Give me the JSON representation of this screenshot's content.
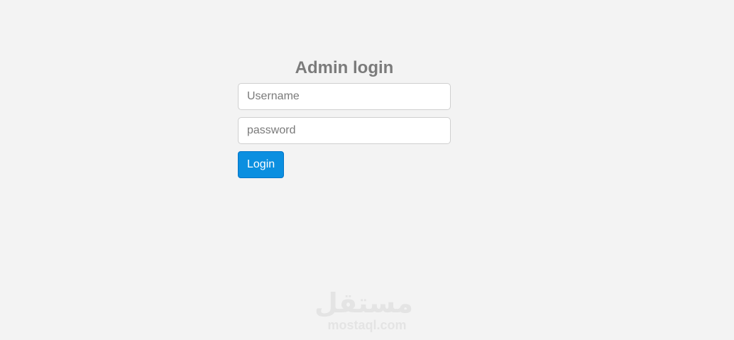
{
  "login_form": {
    "title": "Admin login",
    "username_placeholder": "Username",
    "password_placeholder": "password",
    "username_value": "",
    "password_value": "",
    "login_label": "Login"
  },
  "watermark": {
    "arabic": "مستقل",
    "latin": "mostaql.com"
  },
  "colors": {
    "background": "#f3f3f3",
    "title": "#7b7b7b",
    "button": "#0b8fe0",
    "button_text": "#ffffff",
    "watermark": "#e4e4e4"
  }
}
